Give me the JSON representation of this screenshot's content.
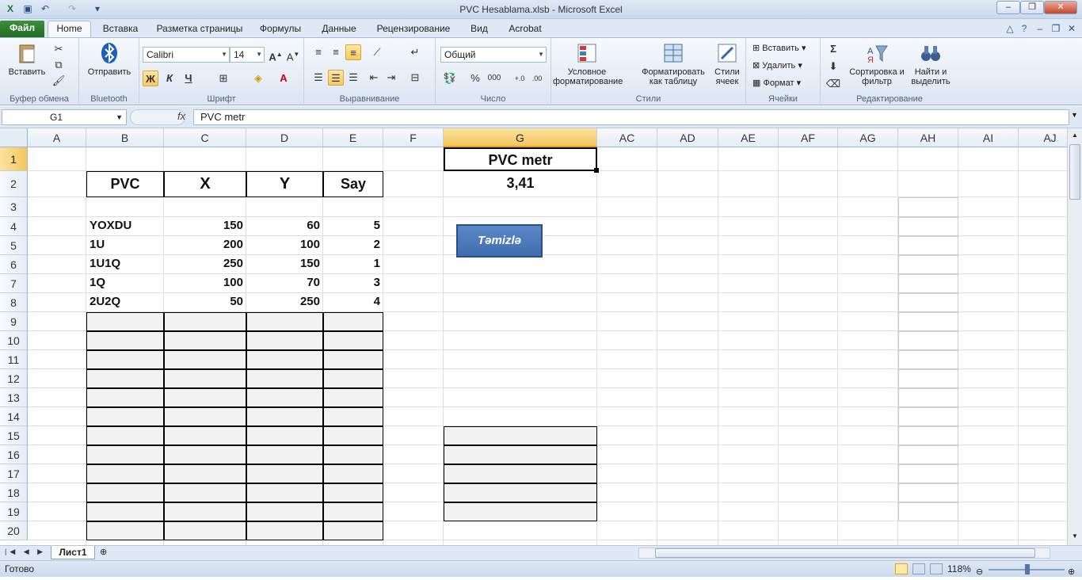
{
  "window": {
    "title": "PVC Hesablama.xlsb - Microsoft Excel"
  },
  "tabs": [
    "Файл",
    "Home",
    "Вставка",
    "Разметка страницы",
    "Формулы",
    "Данные",
    "Рецензирование",
    "Вид",
    "Acrobat"
  ],
  "ribbon": {
    "clipboard": {
      "paste": "Вставить",
      "label": "Буфер обмена"
    },
    "bluetooth": {
      "send": "Отправить",
      "label": "Bluetooth"
    },
    "font": {
      "name": "Calibri",
      "size": "14",
      "bold": "Ж",
      "italic": "К",
      "underline": "Ч",
      "label": "Шрифт"
    },
    "alignment": {
      "label": "Выравнивание"
    },
    "number": {
      "format": "Общий",
      "percent": "%",
      "thousands": "000",
      "label": "Число"
    },
    "styles": {
      "conditional": "Условное форматирование",
      "as_table": "Форматировать как таблицу",
      "cell_styles": "Стили ячеек",
      "label": "Стили"
    },
    "cells": {
      "insert": "Вставить",
      "delete": "Удалить",
      "format": "Формат",
      "label": "Ячейки"
    },
    "editing": {
      "sum": "Σ",
      "sort": "Сортировка и фильтр",
      "find": "Найти и выделить",
      "label": "Редактирование"
    }
  },
  "formula_bar": {
    "name_box": "G1",
    "fx": "fx",
    "formula": "PVC metr"
  },
  "columns": [
    "A",
    "B",
    "C",
    "D",
    "E",
    "F",
    "G",
    "AC",
    "AD",
    "AE",
    "AF",
    "AG",
    "AH",
    "AI",
    "AJ"
  ],
  "rows": [
    "1",
    "2",
    "3",
    "4",
    "5",
    "6",
    "7",
    "8",
    "9",
    "10",
    "11",
    "12",
    "13",
    "14",
    "15",
    "16",
    "17",
    "18",
    "19",
    "20"
  ],
  "table": {
    "headers": [
      "PVC",
      "X",
      "Y",
      "Say"
    ],
    "rows": [
      [
        "YOXDU",
        "150",
        "60",
        "5"
      ],
      [
        "1U",
        "200",
        "100",
        "2"
      ],
      [
        "1U1Q",
        "250",
        "150",
        "1"
      ],
      [
        "1Q",
        "100",
        "70",
        "3"
      ],
      [
        "2U2Q",
        "50",
        "250",
        "4"
      ]
    ]
  },
  "result": {
    "label": "PVC metr",
    "value": "3,41"
  },
  "button": {
    "label": "Təmizlə"
  },
  "sheet_tabs": [
    "Лист1"
  ],
  "status": {
    "ready": "Готово",
    "zoom": "118%"
  }
}
